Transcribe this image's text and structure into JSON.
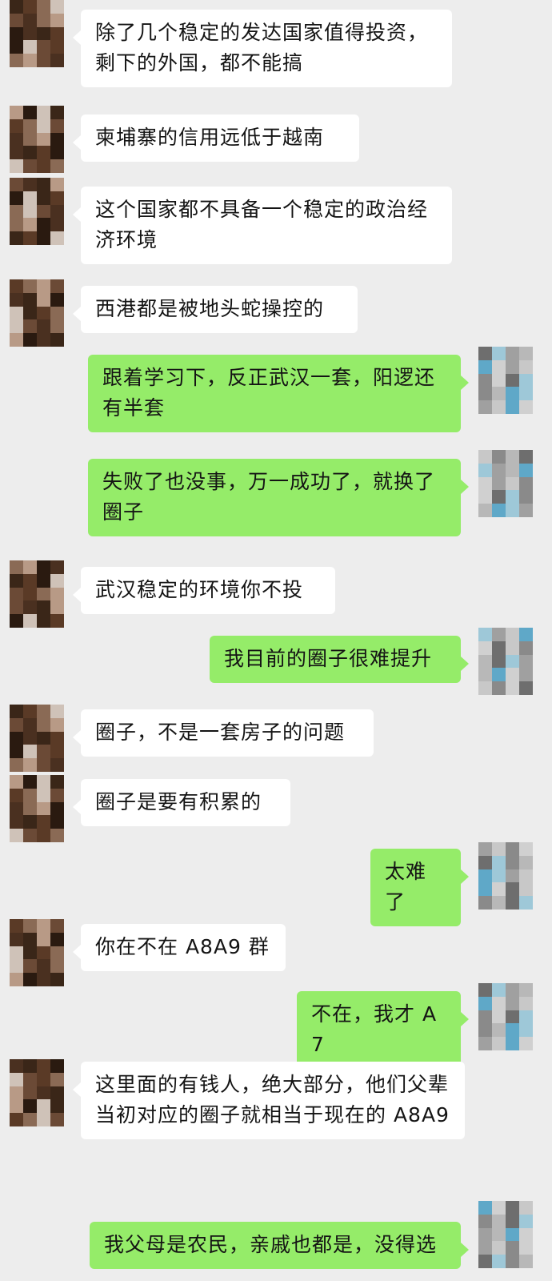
{
  "colors": {
    "background": "#ededed",
    "incoming_bubble": "#ffffff",
    "outgoing_bubble": "#95ec69",
    "text": "#141414"
  },
  "avatars": {
    "left_icon": "pixelated-avatar-icon",
    "right_icon": "pixelated-avatar-icon"
  },
  "messages": [
    {
      "side": "left",
      "text": "除了几个稳定的发达国家值得投资，剩下的外国，都不能搞"
    },
    {
      "side": "left",
      "text": "柬埔寨的信用远低于越南"
    },
    {
      "side": "left",
      "text": "这个国家都不具备一个稳定的政治经济环境"
    },
    {
      "side": "left",
      "text": "西港都是被地头蛇操控的"
    },
    {
      "side": "right",
      "text": "跟着学习下，反正武汉一套，阳逻还有半套"
    },
    {
      "side": "right",
      "text": "失败了也没事，万一成功了，就换了圈子"
    },
    {
      "side": "left",
      "text": "武汉稳定的环境你不投"
    },
    {
      "side": "right",
      "text": "我目前的圈子很难提升"
    },
    {
      "side": "left",
      "text": "圈子，不是一套房子的问题"
    },
    {
      "side": "left",
      "text": "圈子是要有积累的"
    },
    {
      "side": "right",
      "text": "太难了"
    },
    {
      "side": "left",
      "text": "你在不在 A8A9 群"
    },
    {
      "side": "right",
      "text": "不在，我才 A7"
    },
    {
      "side": "left",
      "text": "这里面的有钱人，绝大部分，他们父辈当初对应的圈子就相当于现在的 A8A9"
    },
    {
      "side": "right",
      "text": "我父母是农民，亲戚也都是，没得选"
    }
  ]
}
